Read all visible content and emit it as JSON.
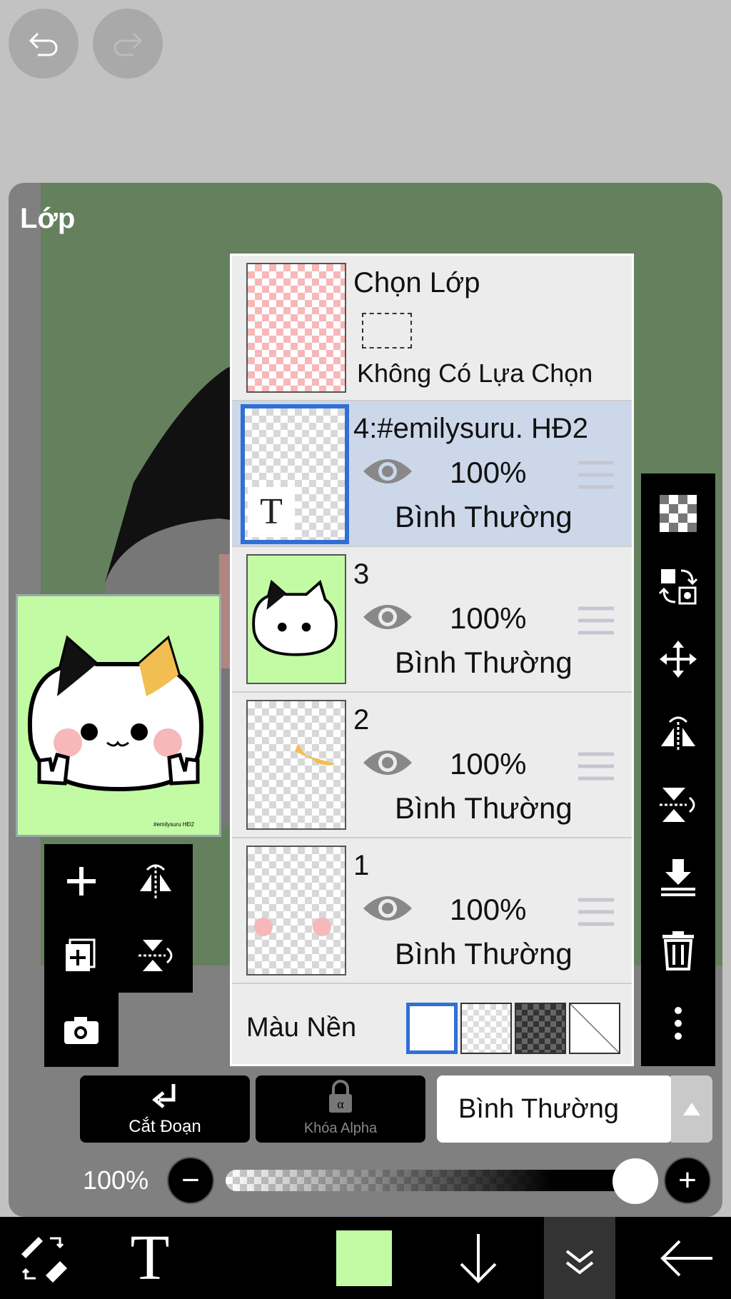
{
  "colors": {
    "canvas": "#65805d",
    "accent_green": "#c2fba4",
    "selected_row": "#ccd8ea",
    "selected_border": "#2f6fd6"
  },
  "panel": {
    "title": "Lớp"
  },
  "selection_layer": {
    "title": "Chọn Lớp",
    "status": "Không Có Lựa Chọn"
  },
  "layers": [
    {
      "name": "4:#emilysuru. HĐ2",
      "opacity": "100%",
      "blend": "Bình Thường",
      "visible": true,
      "selected": true,
      "type": "text"
    },
    {
      "name": "3",
      "opacity": "100%",
      "blend": "Bình Thường",
      "visible": true,
      "selected": false
    },
    {
      "name": "2",
      "opacity": "100%",
      "blend": "Bình Thường",
      "visible": true,
      "selected": false
    },
    {
      "name": "1",
      "opacity": "100%",
      "blend": "Bình Thường",
      "visible": true,
      "selected": false
    }
  ],
  "thumb_text_glyph": "T",
  "background": {
    "label": "Màu Nền",
    "options": [
      "white",
      "light-checker",
      "dark-checker",
      "none"
    ],
    "selected": "white"
  },
  "buttons": {
    "clipping": "Cắt Đoạn",
    "alpha_lock": "Khóa Alpha"
  },
  "blend_mode": {
    "value": "Bình Thường"
  },
  "opacity": {
    "label": "100%",
    "value": 1.0
  },
  "color_swatch": "#c2fba4",
  "watermark": "#emilysuru HĐ2"
}
